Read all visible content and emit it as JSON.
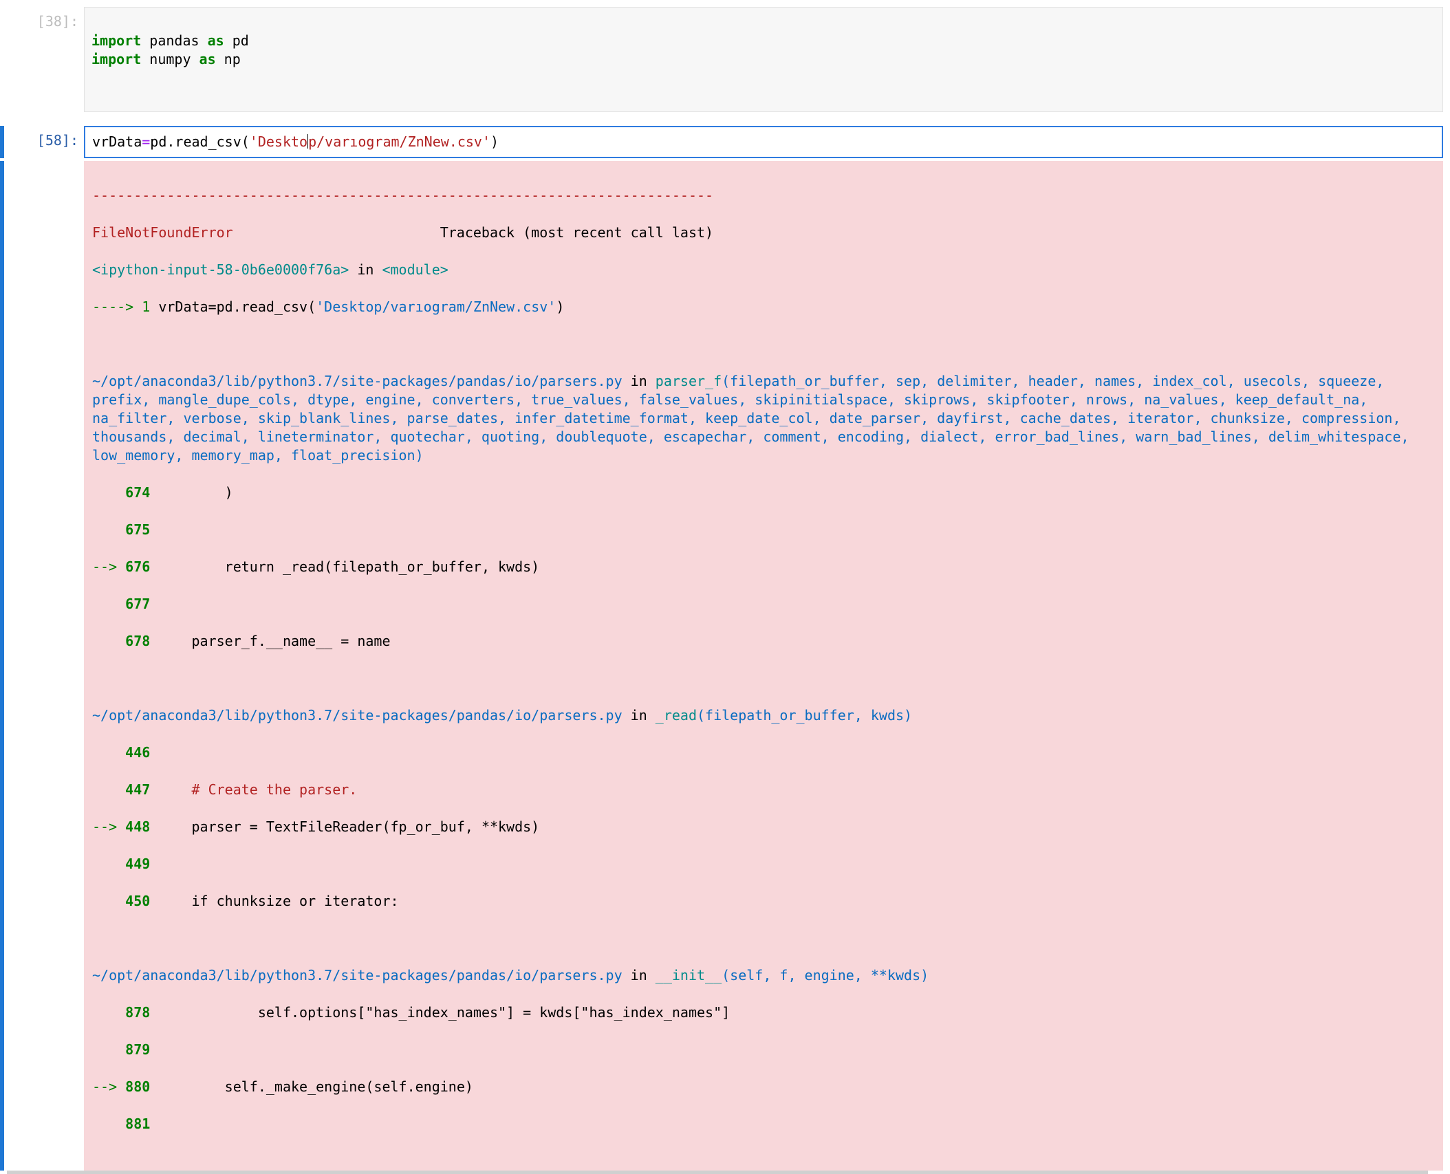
{
  "cells": {
    "cell0": {
      "prompt": "[38]:",
      "line0_kw1": "import",
      "line0_mod": " pandas ",
      "line0_kw2": "as",
      "line0_alias": " pd",
      "line1_kw1": "import",
      "line1_mod": " numpy ",
      "line1_kw2": "as",
      "line1_alias": " np",
      "blank1": "",
      "blank2": "",
      "blank3": ""
    },
    "cell1": {
      "prompt": "[58]:",
      "pre": "vrData",
      "op_eq": "=",
      "mid": "pd.read_csv(",
      "str_a": "'Deskto",
      "str_b": "p/varıogram/ZnNew.csv'",
      "close": ")"
    }
  },
  "traceback": {
    "sep": "---------------------------------------------------------------------------",
    "err_name": "FileNotFoundError",
    "err_tail": "                         Traceback (most recent call last)",
    "ip_src": "<ipython-input-58-0b6e0000f76a>",
    "ip_in": " in ",
    "ip_mod": "<module>",
    "arrow1": "----> 1 ",
    "call_pre": "vrData",
    "call_op": "=",
    "call_mid": "pd.read_csv(",
    "call_str": "'Desktop/varıogram/ZnNew.csv'",
    "call_close": ")",
    "frame1_path": "~/opt/anaconda3/lib/python3.7/site-packages/pandas/io/parsers.py",
    "frame1_in": " in ",
    "frame1_fn": "parser_f",
    "frame1_args": "(filepath_or_buffer, sep, delimiter, header, names, index_col, usecols, squeeze, prefix, mangle_dupe_cols, dtype, engine, converters, true_values, false_values, skipinitialspace, skiprows, skipfooter, nrows, na_values, keep_default_na, na_filter, verbose, skip_blank_lines, parse_dates, infer_datetime_format, keep_date_col, date_parser, dayfirst, cache_dates, iterator, chunksize, compression, thousands, decimal, lineterminator, quotechar, quoting, doublequote, escapechar, comment, encoding, dialect, error_bad_lines, warn_bad_lines, delim_whitespace, low_memory, memory_map, float_precision)",
    "f1_l674_no": "674",
    "f1_l674_body": "         )",
    "f1_l675_no": "675",
    "f1_l675_body": "",
    "f1_arrow": "--> ",
    "f1_l676_no": "676",
    "f1_l676_body": "         return _read(filepath_or_buffer, kwds)",
    "f1_l677_no": "677",
    "f1_l677_body": "",
    "f1_l678_no": "678",
    "f1_l678_body": "     parser_f.__name__ = name",
    "frame2_path": "~/opt/anaconda3/lib/python3.7/site-packages/pandas/io/parsers.py",
    "frame2_in": " in ",
    "frame2_fn": "_read",
    "frame2_args": "(filepath_or_buffer, kwds)",
    "f2_l446_no": "446",
    "f2_l446_body": "",
    "f2_l447_no": "447",
    "f2_l447_body": "     ",
    "f2_l447_comment": "# Create the parser.",
    "f2_arrow": "--> ",
    "f2_l448_no": "448",
    "f2_l448_body": "     parser = TextFileReader(fp_or_buf, **kwds)",
    "f2_l449_no": "449",
    "f2_l449_body": "",
    "f2_l450_no": "450",
    "f2_l450_body": "     if chunksize or iterator:",
    "frame3_path": "~/opt/anaconda3/lib/python3.7/site-packages/pandas/io/parsers.py",
    "frame3_in": " in ",
    "frame3_fn": "__init__",
    "frame3_args": "(self, f, engine, **kwds)",
    "f3_l878_no": "878",
    "f3_l878_body": "             self.options[\"has_index_names\"] = kwds[\"has_index_names\"]",
    "f3_l879_no": "879",
    "f3_l879_body": "",
    "f3_arrow": "--> ",
    "f3_l880_no": "880",
    "f3_l880_body": "         self._make_engine(self.engine)",
    "f3_l881_no": "881",
    "f3_l881_body": "",
    "indent4": "    ",
    "ln_indent": "    "
  }
}
